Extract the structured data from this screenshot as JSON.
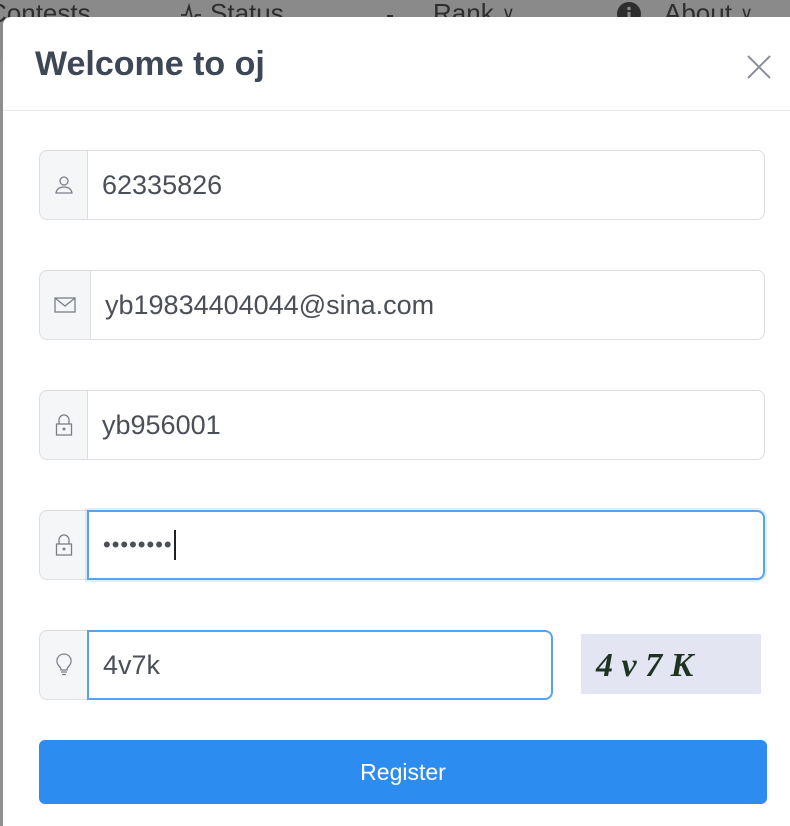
{
  "background_nav": {
    "items": [
      {
        "label": "Contests",
        "icon": ""
      },
      {
        "label": "Status",
        "icon": "pulse-icon"
      },
      {
        "label": "Rank",
        "icon": "bar-chart-icon",
        "chevron": "∨"
      },
      {
        "label": "About",
        "icon": "info-icon",
        "chevron": "∨"
      }
    ]
  },
  "modal": {
    "title": "Welcome to oj",
    "close_icon": "close-icon",
    "fields": {
      "username": {
        "value": "62335826",
        "icon": "user-icon"
      },
      "email": {
        "value": "yb19834404044@sina.com",
        "icon": "mail-icon"
      },
      "password": {
        "value": "yb956001",
        "icon": "lock-icon"
      },
      "password_again": {
        "value": "••••••••",
        "icon": "lock-icon"
      },
      "captcha": {
        "value": "4v7k",
        "icon": "bulb-icon"
      }
    },
    "captcha_image_text": "4 v 7 K",
    "register_label": "Register"
  },
  "colors": {
    "primary": "#2d8cf0",
    "title": "#3e4755",
    "focus_border": "#57a3f3",
    "captcha_bg": "#e3e5f3"
  }
}
